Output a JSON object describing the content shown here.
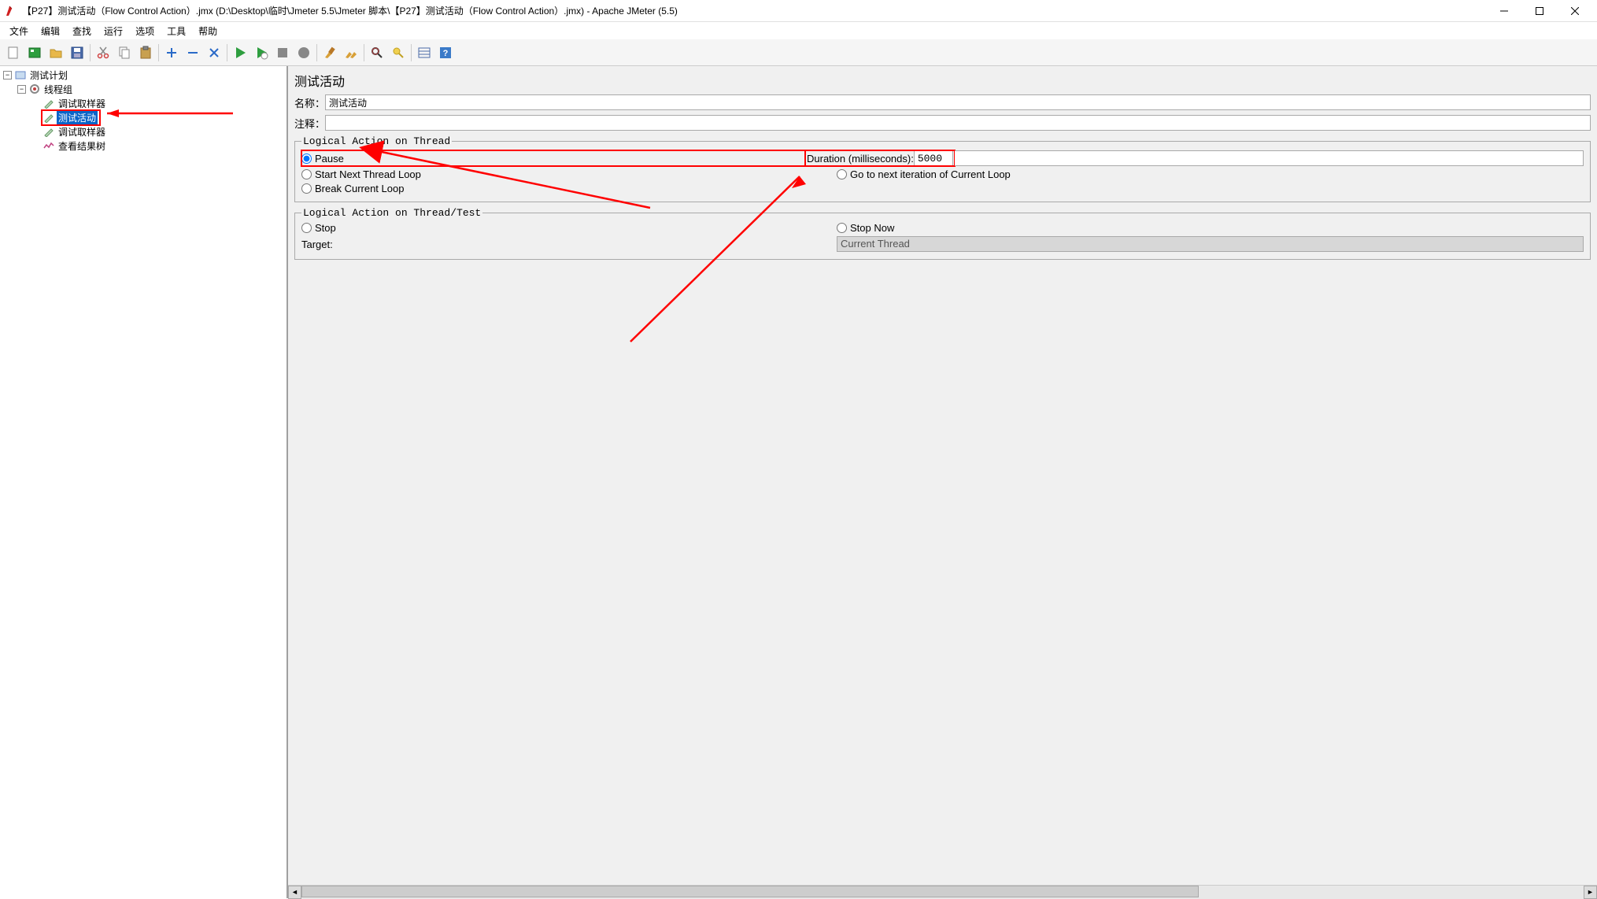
{
  "titlebar": {
    "text": "【P27】测试活动（Flow Control Action）.jmx (D:\\Desktop\\临时\\Jmeter 5.5\\Jmeter 脚本\\【P27】测试活动（Flow Control Action）.jmx) - Apache JMeter (5.5)"
  },
  "menu": {
    "file": "文件",
    "edit": "编辑",
    "search": "查找",
    "run": "运行",
    "options": "选项",
    "tools": "工具",
    "help": "帮助"
  },
  "tree": {
    "root": "测试计划",
    "tg": "线程组",
    "s1": "调试取样器",
    "fc": "测试活动",
    "s2": "调试取样器",
    "res": "查看结果树"
  },
  "panel": {
    "title": "测试活动",
    "name_label": "名称：",
    "name_value": "测试活动",
    "comment_label": "注释：",
    "comment_value": "",
    "fs1_legend": "Logical Action on Thread",
    "pause": "Pause",
    "start_next": "Start Next Thread Loop",
    "break_loop": "Break Current Loop",
    "duration_label": "Duration (milliseconds): ",
    "duration_value": "5000",
    "goto_next": "Go to next iteration of Current Loop",
    "fs2_legend": "Logical Action on Thread/Test",
    "stop": "Stop",
    "stop_now": "Stop Now",
    "target_label": "Target:",
    "target_value": "Current Thread"
  }
}
